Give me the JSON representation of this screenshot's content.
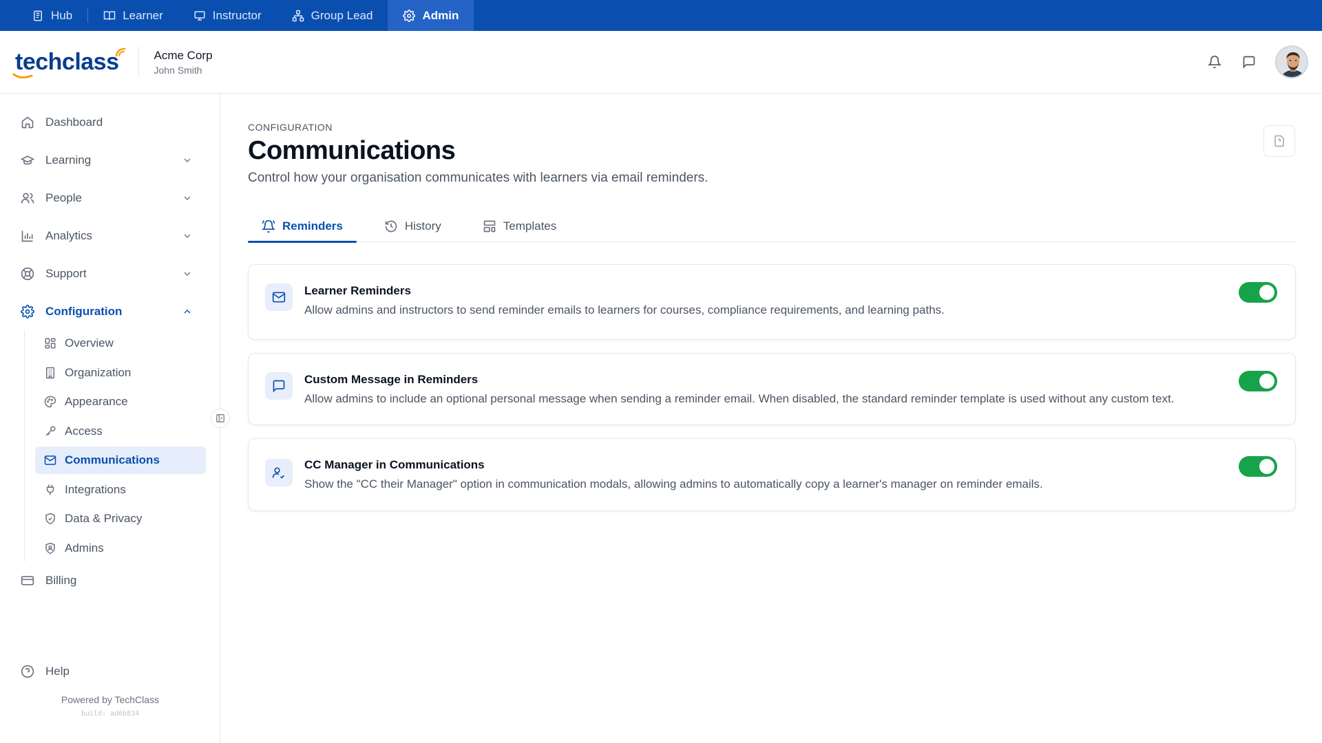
{
  "rolebar": {
    "items": [
      {
        "label": "Hub",
        "icon": "hub-icon"
      },
      {
        "label": "Learner",
        "icon": "book-open-icon"
      },
      {
        "label": "Instructor",
        "icon": "presentation-icon"
      },
      {
        "label": "Group Lead",
        "icon": "org-chart-icon"
      },
      {
        "label": "Admin",
        "icon": "gear-icon",
        "active": true
      }
    ]
  },
  "header": {
    "logo_text": "techclass",
    "org_name": "Acme Corp",
    "user_name": "John Smith",
    "icons": [
      "bell-icon",
      "message-icon",
      "avatar"
    ]
  },
  "sidebar": {
    "items": [
      {
        "label": "Dashboard",
        "icon": "home-icon"
      },
      {
        "label": "Learning",
        "icon": "graduation-cap-icon",
        "expandable": true
      },
      {
        "label": "People",
        "icon": "users-icon",
        "expandable": true
      },
      {
        "label": "Analytics",
        "icon": "bar-chart-icon",
        "expandable": true
      },
      {
        "label": "Support",
        "icon": "lifebuoy-icon",
        "expandable": true
      },
      {
        "label": "Configuration",
        "icon": "gear-icon",
        "expanded": true
      }
    ],
    "config_items": [
      {
        "label": "Overview",
        "icon": "grid-icon"
      },
      {
        "label": "Organization",
        "icon": "building-icon"
      },
      {
        "label": "Appearance",
        "icon": "palette-icon"
      },
      {
        "label": "Access",
        "icon": "key-icon"
      },
      {
        "label": "Communications",
        "icon": "mail-icon",
        "active": true
      },
      {
        "label": "Integrations",
        "icon": "plug-icon"
      },
      {
        "label": "Data & Privacy",
        "icon": "shield-icon"
      },
      {
        "label": "Admins",
        "icon": "shield-user-icon"
      }
    ],
    "billing": {
      "label": "Billing",
      "icon": "credit-card-icon"
    },
    "help": {
      "label": "Help",
      "icon": "help-circle-icon"
    },
    "powered_by": "Powered by TechClass",
    "build": "build: ad6b834"
  },
  "page": {
    "eyebrow": "CONFIGURATION",
    "title": "Communications",
    "subtitle": "Control how your organisation communicates with learners via email reminders."
  },
  "tabs": [
    {
      "label": "Reminders",
      "icon": "bell-ring-icon",
      "active": true
    },
    {
      "label": "History",
      "icon": "history-icon"
    },
    {
      "label": "Templates",
      "icon": "template-icon"
    }
  ],
  "cards": [
    {
      "title": "Learner Reminders",
      "description": "Allow admins and instructors to send reminder emails to learners for courses, compliance requirements, and learning paths.",
      "icon": "mail-icon",
      "enabled": true
    },
    {
      "title": "Custom Message in Reminders",
      "description": "Allow admins to include an optional personal message when sending a reminder email. When disabled, the standard reminder template is used without any custom text.",
      "icon": "message-square-icon",
      "enabled": true
    },
    {
      "title": "CC Manager in Communications",
      "description": "Show the \"CC their Manager\" option in communication modals, allowing admins to automatically copy a learner's manager on reminder emails.",
      "icon": "user-check-icon",
      "enabled": true
    }
  ],
  "colors": {
    "brand": "#0a4fb0",
    "toggle_on": "#16a34a",
    "active_bg": "#e6eefb"
  }
}
